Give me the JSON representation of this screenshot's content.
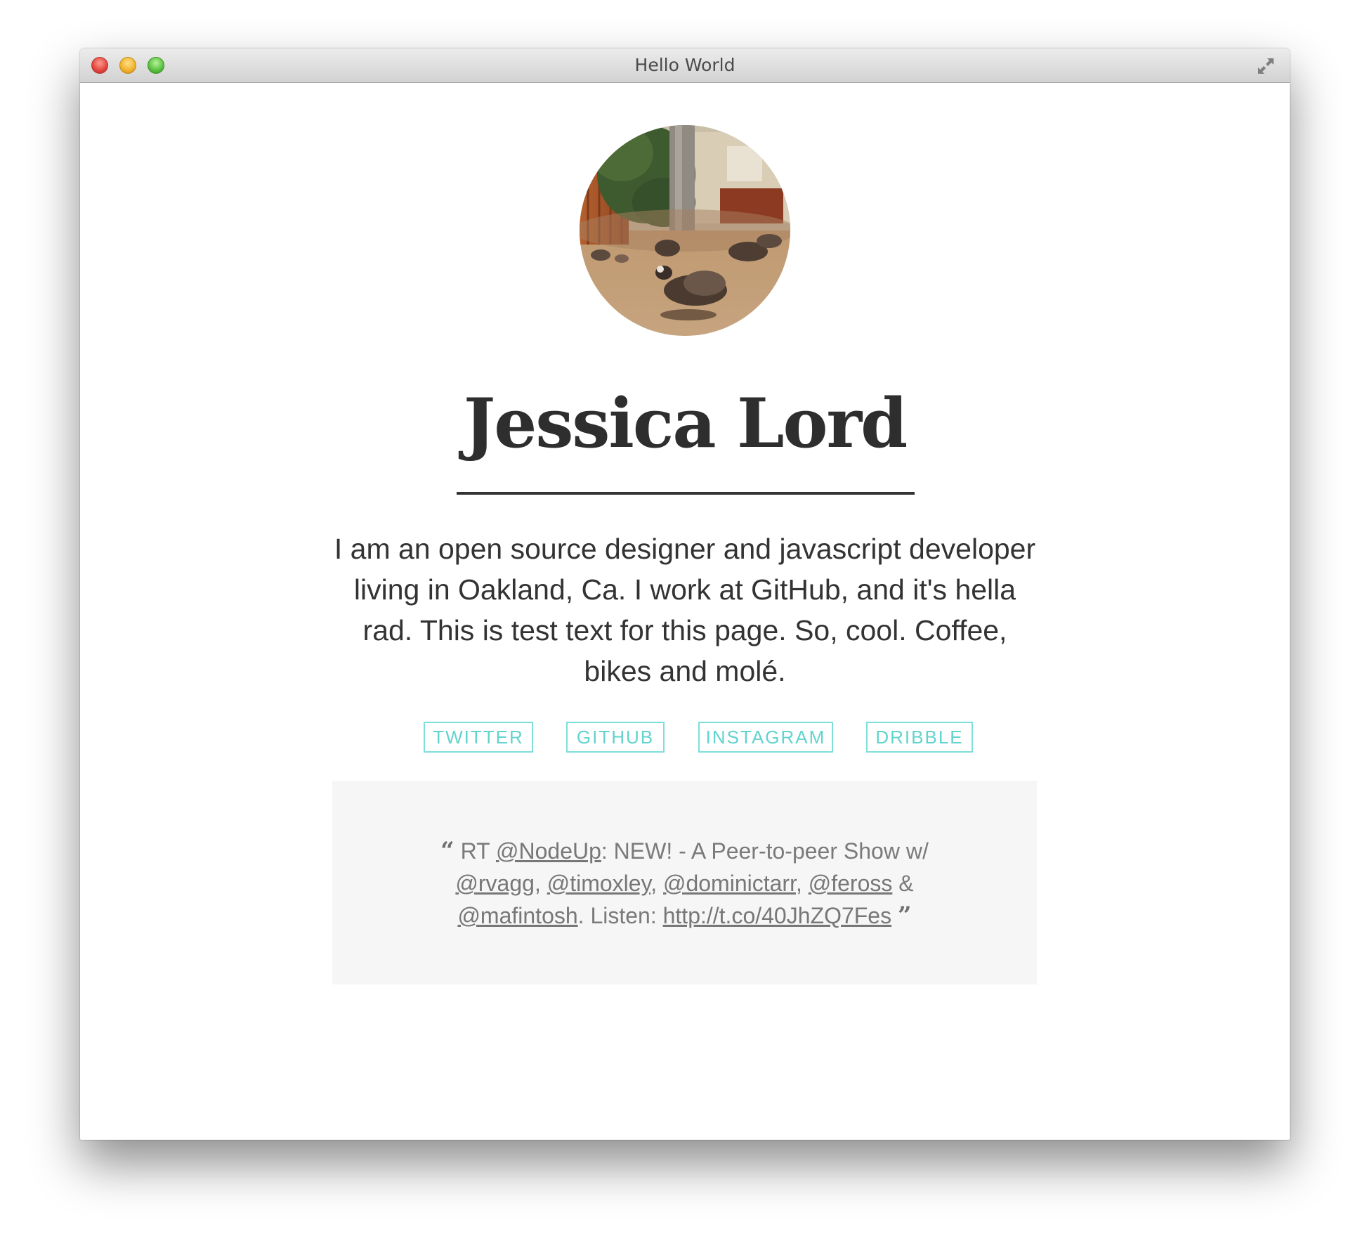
{
  "window": {
    "title": "Hello World"
  },
  "profile": {
    "name": "Jessica Lord",
    "bio": "I am an open source designer and javascript developer living in Oakland, Ca. I work at GitHub, and it's hella rad. This is test text for this page. So, cool. Coffee, bikes and molé.",
    "avatar_icon": "turkeys-photo-avatar"
  },
  "social": {
    "twitter": "TWITTER",
    "github": "GITHUB",
    "instagram": "INSTAGRAM",
    "dribble": "DRIBBLE",
    "accent_color": "#62d3cd"
  },
  "tweet": {
    "open_quote": "“",
    "close_quote": "”",
    "prefix": "RT",
    "mention_nodeup": "@NodeUp",
    "text_1": ": NEW! - A Peer-to-peer Show w/",
    "mention_rvagg": "@rvagg",
    "mention_timoxley": "@timoxley",
    "mention_dominictarr": "@dominictarr",
    "mention_feross": "@feross",
    "amp": "&",
    "mention_mafintosh": "@mafintosh",
    "text_2": ". Listen:",
    "link": "http://t.co/40JhZQ7Fes"
  }
}
